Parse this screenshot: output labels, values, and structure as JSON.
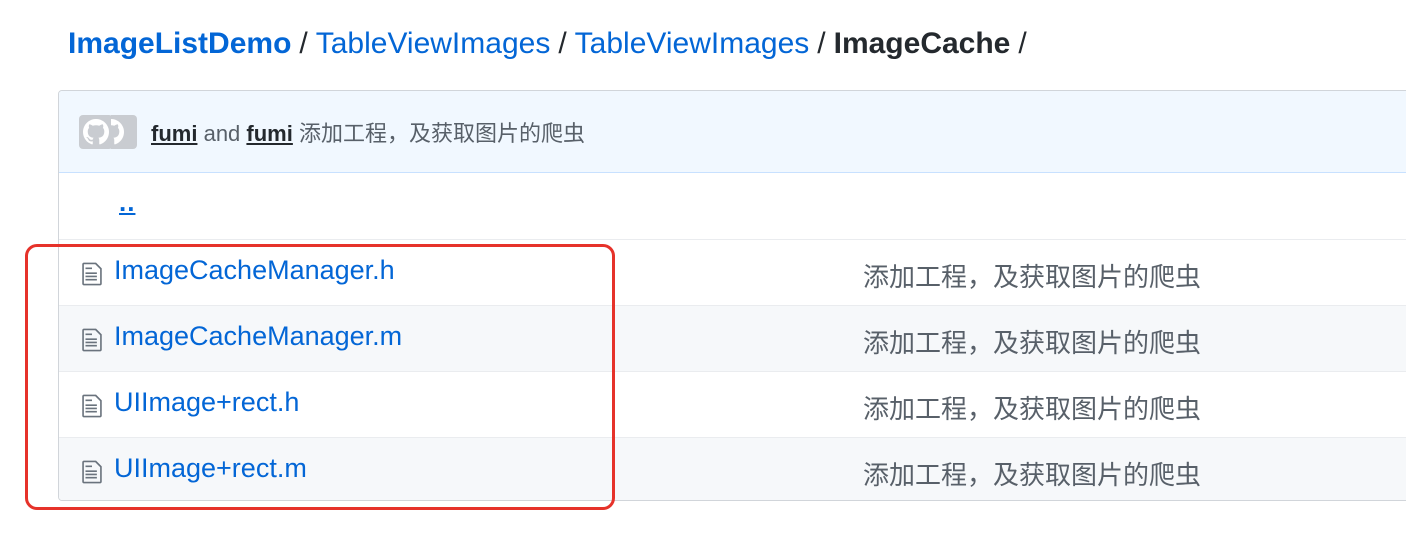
{
  "breadcrumb": {
    "root": "ImageListDemo",
    "sep": "/",
    "crumb1": "TableViewImages",
    "crumb2": "TableViewImages",
    "current": "ImageCache"
  },
  "commit": {
    "author1": "fumi",
    "and": "and",
    "author2": "fumi",
    "message": "添加工程，及获取图片的爬虫",
    "avatar_icon": "github-octocat-icon"
  },
  "parent_dir": "..",
  "files": [
    {
      "name": "ImageCacheManager.h",
      "message": "添加工程，及获取图片的爬虫",
      "icon": "file-icon"
    },
    {
      "name": "ImageCacheManager.m",
      "message": "添加工程，及获取图片的爬虫",
      "icon": "file-icon"
    },
    {
      "name": "UIImage+rect.h",
      "message": "添加工程，及获取图片的爬虫",
      "icon": "file-icon"
    },
    {
      "name": "UIImage+rect.m",
      "message": "添加工程，及获取图片的爬虫",
      "icon": "file-icon"
    }
  ],
  "colors": {
    "link": "#0366d6",
    "annotation": "#e6322a"
  }
}
